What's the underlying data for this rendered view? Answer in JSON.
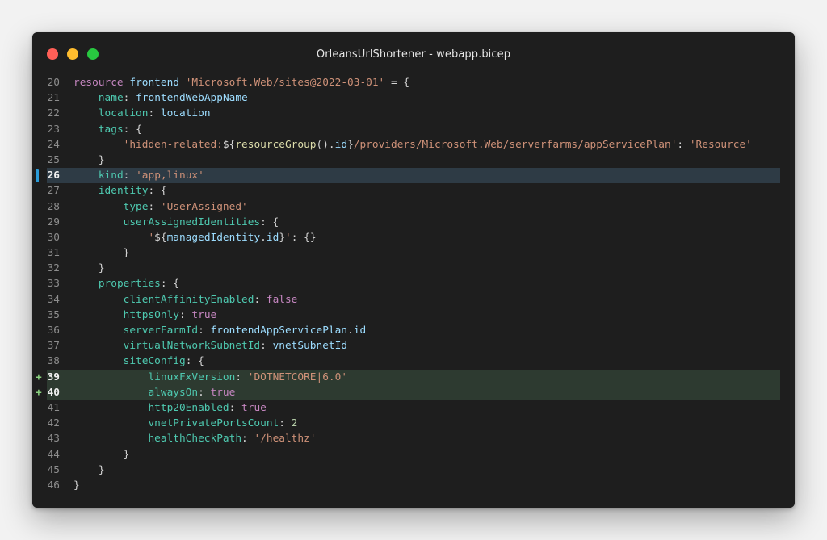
{
  "window": {
    "title": "OrleansUrlShortener - webapp.bicep"
  },
  "editor": {
    "lines": [
      {
        "number": "20",
        "state": "",
        "marker": "",
        "tokens": [
          [
            "k",
            "resource"
          ],
          [
            "o",
            " "
          ],
          [
            "i",
            "frontend"
          ],
          [
            "o",
            " "
          ],
          [
            "s",
            "'Microsoft.Web/sites@2022-03-01'"
          ],
          [
            "o",
            " = {"
          ]
        ]
      },
      {
        "number": "21",
        "state": "",
        "marker": "",
        "tokens": [
          [
            "o",
            "    "
          ],
          [
            "p",
            "name"
          ],
          [
            "o",
            ": "
          ],
          [
            "i",
            "frontendWebAppName"
          ]
        ]
      },
      {
        "number": "22",
        "state": "",
        "marker": "",
        "tokens": [
          [
            "o",
            "    "
          ],
          [
            "p",
            "location"
          ],
          [
            "o",
            ": "
          ],
          [
            "i",
            "location"
          ]
        ]
      },
      {
        "number": "23",
        "state": "",
        "marker": "",
        "tokens": [
          [
            "o",
            "    "
          ],
          [
            "p",
            "tags"
          ],
          [
            "o",
            ": {"
          ]
        ]
      },
      {
        "number": "24",
        "state": "",
        "marker": "",
        "tokens": [
          [
            "o",
            "        "
          ],
          [
            "s",
            "'hidden-related:"
          ],
          [
            "o",
            "${"
          ],
          [
            "f",
            "resourceGroup"
          ],
          [
            "o",
            "()."
          ],
          [
            "i",
            "id"
          ],
          [
            "o",
            "}"
          ],
          [
            "s",
            "/providers/Microsoft.Web/serverfarms/appServicePlan'"
          ],
          [
            "o",
            ": "
          ],
          [
            "s",
            "'Resource'"
          ]
        ]
      },
      {
        "number": "25",
        "state": "",
        "marker": "",
        "tokens": [
          [
            "o",
            "    }"
          ]
        ]
      },
      {
        "number": "26",
        "state": "focus",
        "marker": "",
        "tokens": [
          [
            "o",
            "    "
          ],
          [
            "p",
            "kind"
          ],
          [
            "o",
            ": "
          ],
          [
            "s",
            "'app,linux'"
          ]
        ]
      },
      {
        "number": "27",
        "state": "",
        "marker": "",
        "tokens": [
          [
            "o",
            "    "
          ],
          [
            "p",
            "identity"
          ],
          [
            "o",
            ": {"
          ]
        ]
      },
      {
        "number": "28",
        "state": "",
        "marker": "",
        "tokens": [
          [
            "o",
            "        "
          ],
          [
            "p",
            "type"
          ],
          [
            "o",
            ": "
          ],
          [
            "s",
            "'UserAssigned'"
          ]
        ]
      },
      {
        "number": "29",
        "state": "",
        "marker": "",
        "tokens": [
          [
            "o",
            "        "
          ],
          [
            "p",
            "userAssignedIdentities"
          ],
          [
            "o",
            ": {"
          ]
        ]
      },
      {
        "number": "30",
        "state": "",
        "marker": "",
        "tokens": [
          [
            "o",
            "            "
          ],
          [
            "s",
            "'"
          ],
          [
            "o",
            "${"
          ],
          [
            "i",
            "managedIdentity"
          ],
          [
            "o",
            "."
          ],
          [
            "i",
            "id"
          ],
          [
            "o",
            "}"
          ],
          [
            "s",
            "'"
          ],
          [
            "o",
            ": {}"
          ]
        ]
      },
      {
        "number": "31",
        "state": "",
        "marker": "",
        "tokens": [
          [
            "o",
            "        }"
          ]
        ]
      },
      {
        "number": "32",
        "state": "",
        "marker": "",
        "tokens": [
          [
            "o",
            "    }"
          ]
        ]
      },
      {
        "number": "33",
        "state": "",
        "marker": "",
        "tokens": [
          [
            "o",
            "    "
          ],
          [
            "p",
            "properties"
          ],
          [
            "o",
            ": {"
          ]
        ]
      },
      {
        "number": "34",
        "state": "",
        "marker": "",
        "tokens": [
          [
            "o",
            "        "
          ],
          [
            "p",
            "clientAffinityEnabled"
          ],
          [
            "o",
            ": "
          ],
          [
            "k",
            "false"
          ]
        ]
      },
      {
        "number": "35",
        "state": "",
        "marker": "",
        "tokens": [
          [
            "o",
            "        "
          ],
          [
            "p",
            "httpsOnly"
          ],
          [
            "o",
            ": "
          ],
          [
            "k",
            "true"
          ]
        ]
      },
      {
        "number": "36",
        "state": "",
        "marker": "",
        "tokens": [
          [
            "o",
            "        "
          ],
          [
            "p",
            "serverFarmId"
          ],
          [
            "o",
            ": "
          ],
          [
            "i",
            "frontendAppServicePlan"
          ],
          [
            "o",
            "."
          ],
          [
            "i",
            "id"
          ]
        ]
      },
      {
        "number": "37",
        "state": "",
        "marker": "",
        "tokens": [
          [
            "o",
            "        "
          ],
          [
            "p",
            "virtualNetworkSubnetId"
          ],
          [
            "o",
            ": "
          ],
          [
            "i",
            "vnetSubnetId"
          ]
        ]
      },
      {
        "number": "38",
        "state": "",
        "marker": "",
        "tokens": [
          [
            "o",
            "        "
          ],
          [
            "p",
            "siteConfig"
          ],
          [
            "o",
            ": {"
          ]
        ]
      },
      {
        "number": "39",
        "state": "add",
        "marker": "+",
        "tokens": [
          [
            "o",
            "            "
          ],
          [
            "p",
            "linuxFxVersion"
          ],
          [
            "o",
            ": "
          ],
          [
            "s",
            "'DOTNETCORE|6.0'"
          ]
        ]
      },
      {
        "number": "40",
        "state": "add",
        "marker": "+",
        "tokens": [
          [
            "o",
            "            "
          ],
          [
            "p",
            "alwaysOn"
          ],
          [
            "o",
            ": "
          ],
          [
            "k",
            "true"
          ]
        ]
      },
      {
        "number": "41",
        "state": "",
        "marker": "",
        "tokens": [
          [
            "o",
            "            "
          ],
          [
            "p",
            "http20Enabled"
          ],
          [
            "o",
            ": "
          ],
          [
            "k",
            "true"
          ]
        ]
      },
      {
        "number": "42",
        "state": "",
        "marker": "",
        "tokens": [
          [
            "o",
            "            "
          ],
          [
            "p",
            "vnetPrivatePortsCount"
          ],
          [
            "o",
            ": "
          ],
          [
            "n",
            "2"
          ]
        ]
      },
      {
        "number": "43",
        "state": "",
        "marker": "",
        "tokens": [
          [
            "o",
            "            "
          ],
          [
            "p",
            "healthCheckPath"
          ],
          [
            "o",
            ": "
          ],
          [
            "s",
            "'/healthz'"
          ]
        ]
      },
      {
        "number": "44",
        "state": "",
        "marker": "",
        "tokens": [
          [
            "o",
            "        }"
          ]
        ]
      },
      {
        "number": "45",
        "state": "",
        "marker": "",
        "tokens": [
          [
            "o",
            "    }"
          ]
        ]
      },
      {
        "number": "46",
        "state": "",
        "marker": "",
        "tokens": [
          [
            "o",
            "}"
          ]
        ]
      }
    ]
  }
}
